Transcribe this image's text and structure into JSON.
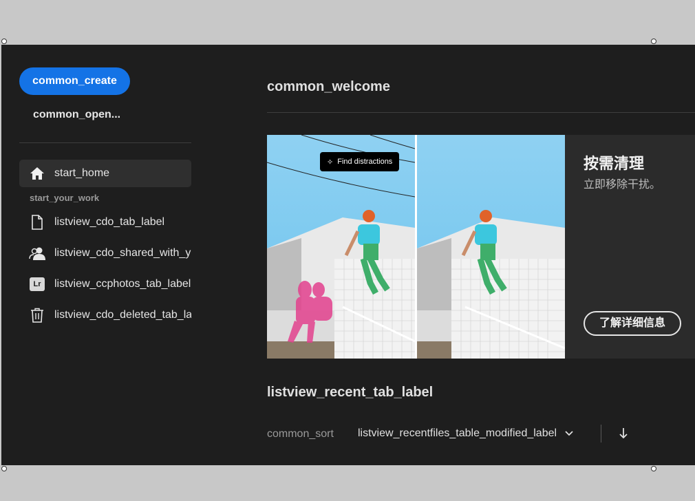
{
  "sidebar": {
    "create_label": "common_create",
    "open_label": "common_open...",
    "section_label": "start_your_work",
    "items": [
      {
        "label": "start_home",
        "icon": "home-icon"
      },
      {
        "label": "listview_cdo_tab_label",
        "icon": "document-icon"
      },
      {
        "label": "listview_cdo_shared_with_you_",
        "icon": "shared-users-icon"
      },
      {
        "label": "listview_ccphotos_tab_label",
        "icon": "lightroom-icon",
        "icon_text": "Lr"
      },
      {
        "label": "listview_cdo_deleted_tab_label",
        "icon": "trash-icon"
      }
    ]
  },
  "main": {
    "welcome": "common_welcome",
    "banner": {
      "tag": "Find distractions",
      "title": "按需清理",
      "subtitle": "立即移除干扰。",
      "button": "了解详细信息"
    },
    "recent_title": "listview_recent_tab_label",
    "sort_label": "common_sort",
    "sort_value": "listview_recentfiles_table_modified_label"
  },
  "colors": {
    "accent": "#1473e6",
    "app_bg": "#1e1e1e",
    "outer_bg": "#c8c8c8"
  }
}
